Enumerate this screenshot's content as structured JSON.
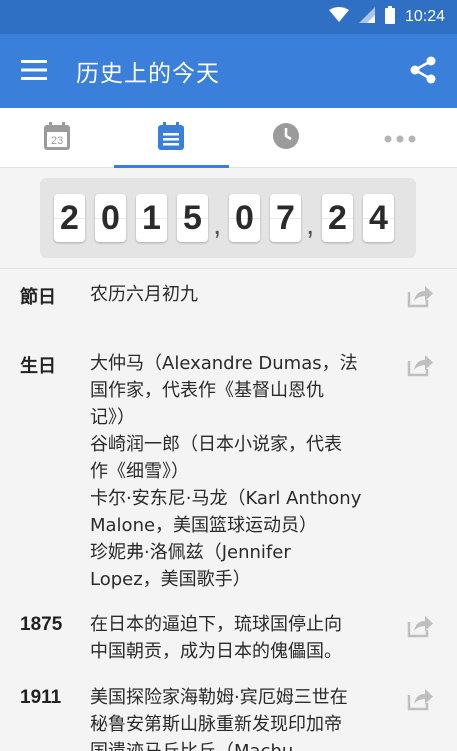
{
  "status_bar": {
    "time": "10:24"
  },
  "app_bar": {
    "title": "历史上的今天"
  },
  "tabs": [
    {
      "icon": "calendar-day-icon",
      "badge": "23"
    },
    {
      "icon": "calendar-list-icon"
    },
    {
      "icon": "clock-icon"
    },
    {
      "icon": "more-icon"
    }
  ],
  "date": {
    "year_digits": [
      "2",
      "0",
      "1",
      "5"
    ],
    "month_digits": [
      "0",
      "7"
    ],
    "day_digits": [
      "2",
      "4"
    ],
    "separator": ","
  },
  "events": [
    {
      "label": "節日",
      "lines": [
        "农历六月初九"
      ]
    },
    {
      "label": "生日",
      "lines": [
        "大仲马（Alexandre Dumas，法",
        "国作家，代表作《基督山恩仇",
        "记》）",
        "谷崎润一郎（日本小说家，代表",
        "作《细雪》）",
        "卡尔·安东尼·马龙（Karl Anthony",
        "Malone，美国篮球运动员）",
        "珍妮弗·洛佩兹（Jennifer",
        "Lopez，美国歌手）"
      ]
    },
    {
      "label": "1875",
      "lines": [
        "在日本的逼迫下，琉球国停止向",
        "中国朝贡，成为日本的傀儡国。"
      ]
    },
    {
      "label": "1911",
      "lines": [
        "美国探险家海勒姆·宾厄姆三世在",
        "秘鲁安第斯山脉重新发现印加帝",
        "国遗迹马丘比丘（Machu"
      ]
    }
  ],
  "colors": {
    "primary": "#3a7fd9",
    "status_bar": "#2f6fc4"
  }
}
